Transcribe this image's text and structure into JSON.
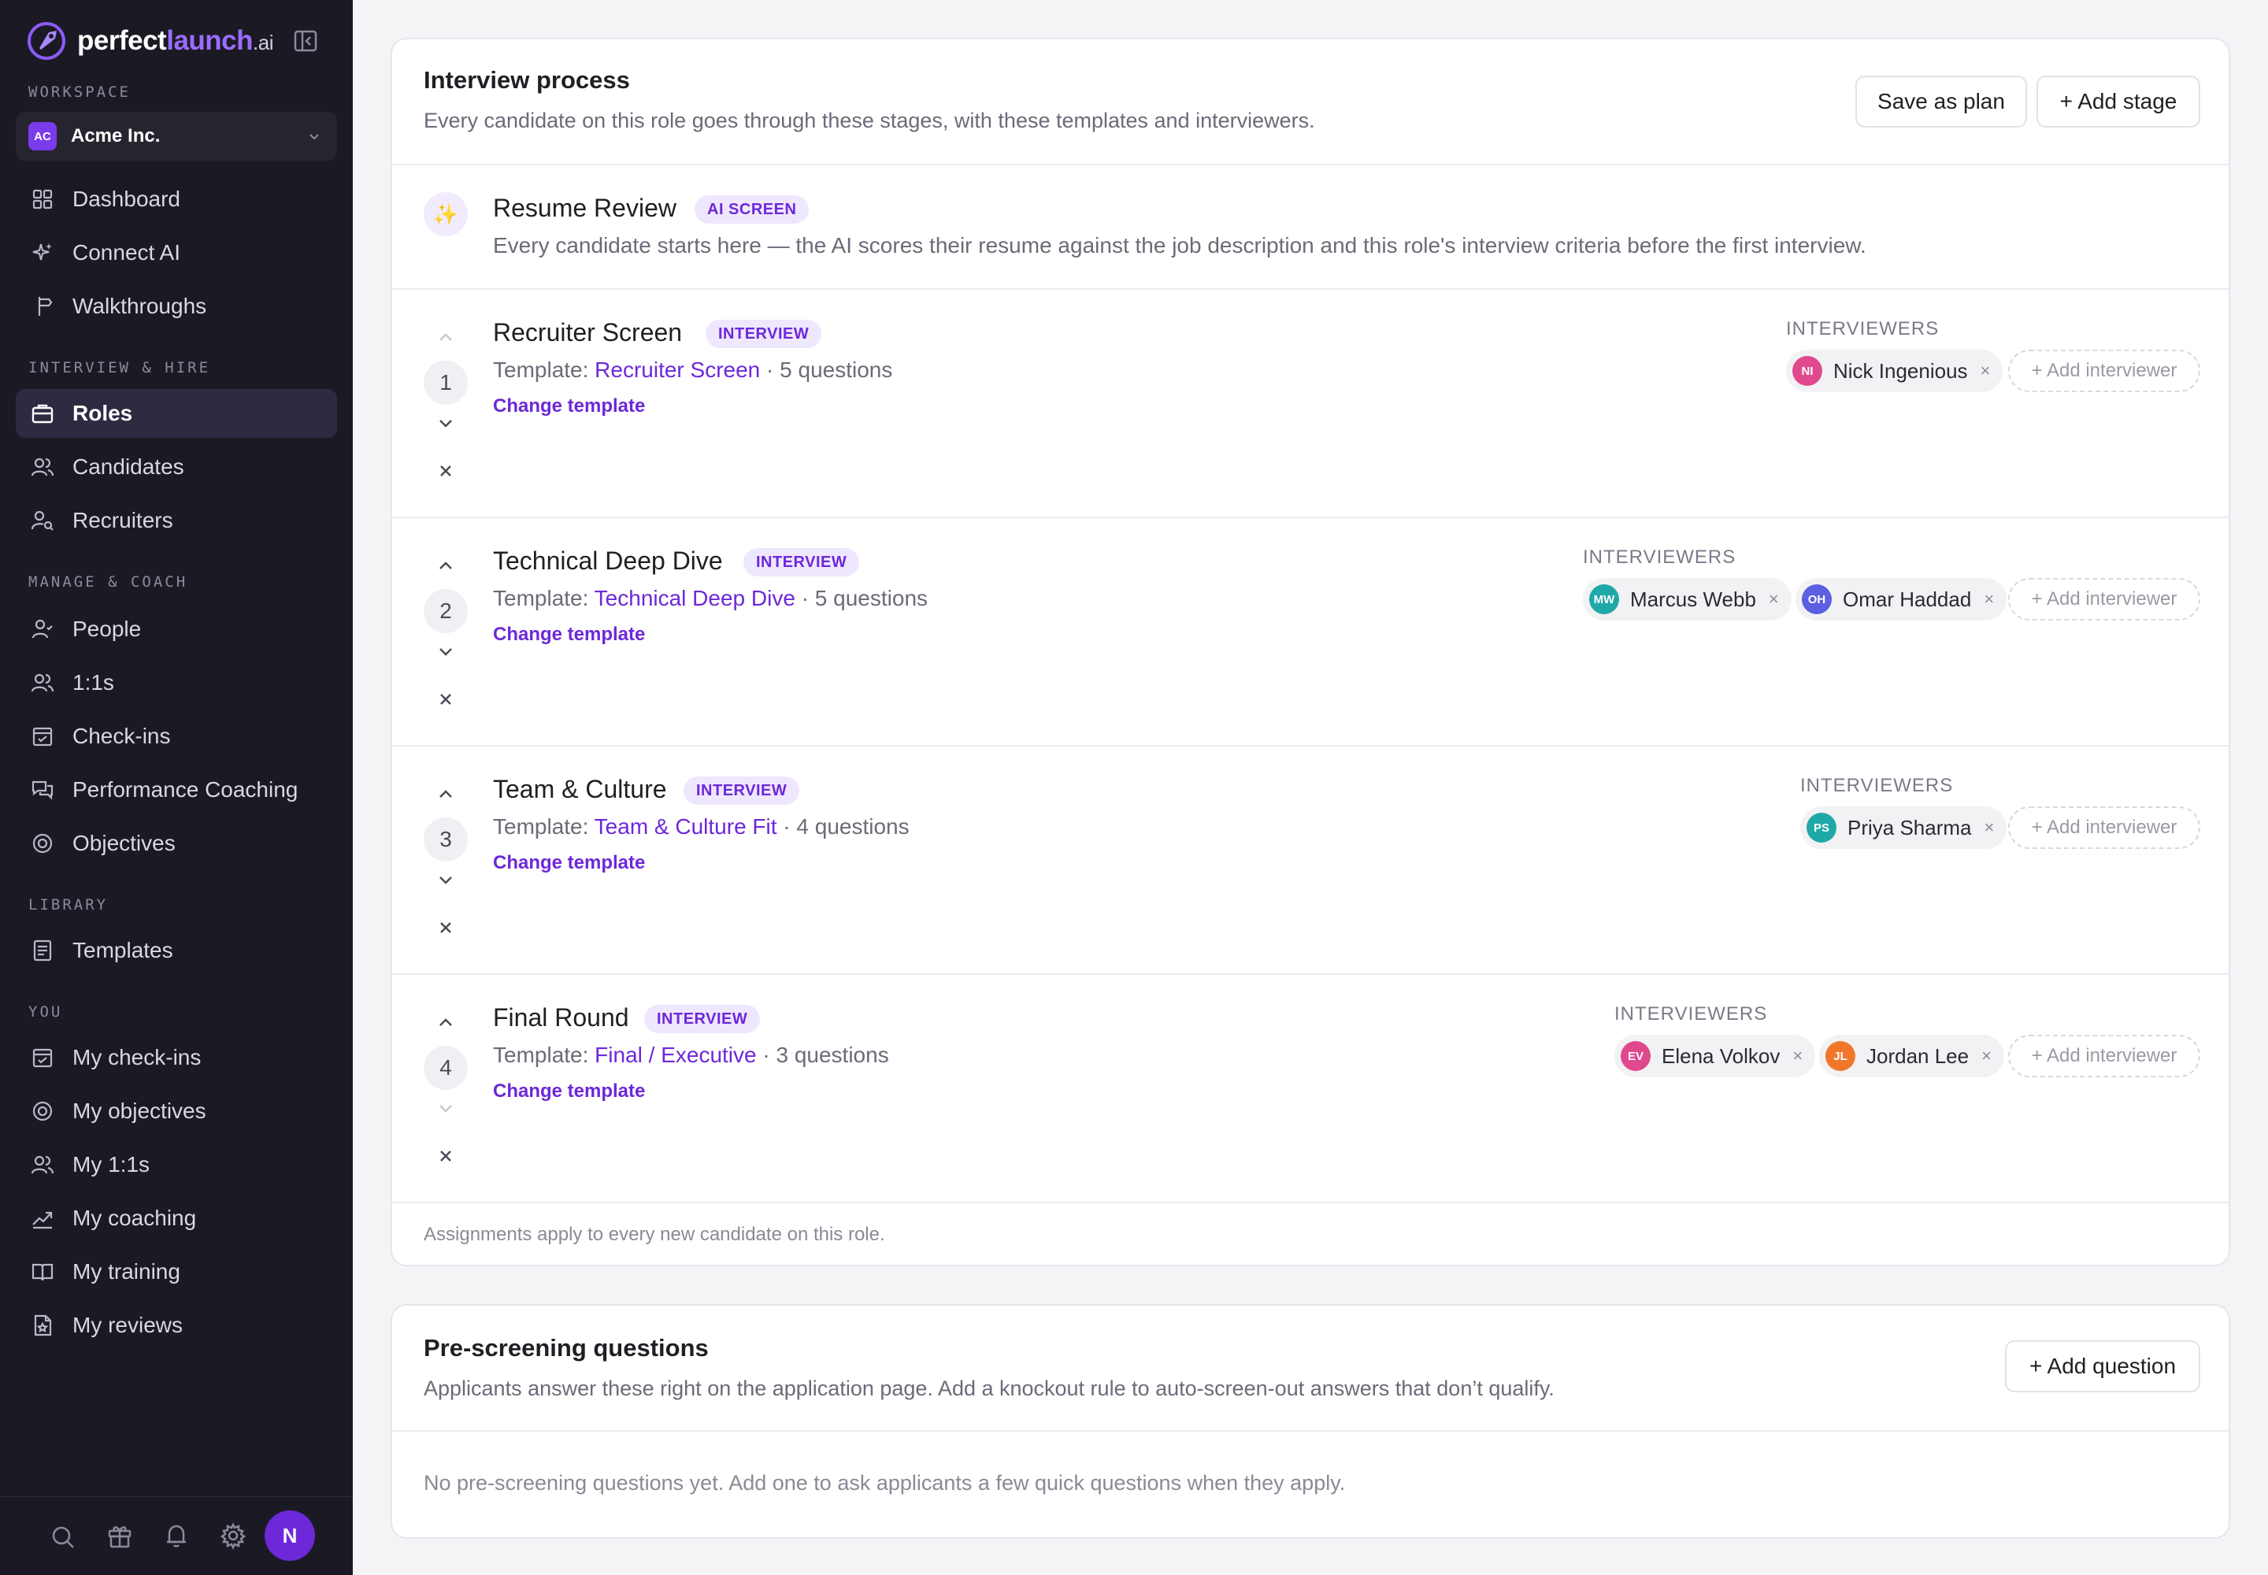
{
  "brand": {
    "name_main": "perfect",
    "name_accent": "launch",
    "name_suffix": ".ai"
  },
  "sidebar": {
    "workspace_label": "WORKSPACE",
    "workspace": {
      "badge": "AC",
      "name": "Acme Inc."
    },
    "sections": {
      "interview_hire": "INTERVIEW & HIRE",
      "manage_coach": "MANAGE & COACH",
      "library": "LIBRARY",
      "you": "YOU"
    },
    "items": [
      {
        "label": "Dashboard",
        "icon": "dashboard-icon"
      },
      {
        "label": "Connect AI",
        "icon": "sparkle-icon"
      },
      {
        "label": "Walkthroughs",
        "icon": "signpost-icon"
      },
      {
        "label": "Roles",
        "icon": "briefcase-icon",
        "active": true
      },
      {
        "label": "Candidates",
        "icon": "users-icon"
      },
      {
        "label": "Recruiters",
        "icon": "user-search-icon"
      },
      {
        "label": "People",
        "icon": "user-icon"
      },
      {
        "label": "1:1s",
        "icon": "users-icon"
      },
      {
        "label": "Check-ins",
        "icon": "calendar-check-icon"
      },
      {
        "label": "Performance Coaching",
        "icon": "chat-icon"
      },
      {
        "label": "Objectives",
        "icon": "target-icon"
      },
      {
        "label": "Templates",
        "icon": "document-icon"
      },
      {
        "label": "My check-ins",
        "icon": "calendar-check-icon"
      },
      {
        "label": "My objectives",
        "icon": "target-icon"
      },
      {
        "label": "My 1:1s",
        "icon": "users-icon"
      },
      {
        "label": "My coaching",
        "icon": "trend-icon"
      },
      {
        "label": "My training",
        "icon": "book-icon"
      },
      {
        "label": "My reviews",
        "icon": "review-icon"
      }
    ],
    "user_initial": "N"
  },
  "interview": {
    "title": "Interview process",
    "subtitle": "Every candidate on this role goes through these stages, with these templates and interviewers.",
    "save_plan": "Save as plan",
    "add_stage": "+ Add stage",
    "resume": {
      "title": "Resume Review",
      "tag": "AI SCREEN",
      "desc": "Every candidate starts here — the AI scores their resume against the job description and this role's interview criteria before the first interview."
    },
    "template_prefix": "Template: ",
    "change_template": "Change template",
    "interviewers_label": "INTERVIEWERS",
    "add_interviewer": "+ Add interviewer",
    "stages": [
      {
        "num": "1",
        "title": "Recruiter Screen",
        "tag": "INTERVIEW",
        "template": "Recruiter Screen",
        "questions": " · 5 questions",
        "interviewers": [
          {
            "initials": "NI",
            "name": "Nick Ingenious",
            "color": "#e0498e"
          }
        ]
      },
      {
        "num": "2",
        "title": "Technical Deep Dive",
        "tag": "INTERVIEW",
        "template": "Technical Deep Dive",
        "questions": " · 5 questions",
        "interviewers": [
          {
            "initials": "MW",
            "name": "Marcus Webb",
            "color": "#1fa8a8"
          },
          {
            "initials": "OH",
            "name": "Omar Haddad",
            "color": "#5b5fe0"
          }
        ]
      },
      {
        "num": "3",
        "title": "Team & Culture",
        "tag": "INTERVIEW",
        "template": "Team & Culture Fit",
        "questions": " · 4 questions",
        "interviewers": [
          {
            "initials": "PS",
            "name": "Priya Sharma",
            "color": "#1fa8a8"
          }
        ]
      },
      {
        "num": "4",
        "title": "Final Round",
        "tag": "INTERVIEW",
        "template": "Final / Executive",
        "questions": " · 3 questions",
        "interviewers": [
          {
            "initials": "EV",
            "name": "Elena Volkov",
            "color": "#e0498e"
          },
          {
            "initials": "JL",
            "name": "Jordan Lee",
            "color": "#f0772a"
          }
        ]
      }
    ],
    "footnote": "Assignments apply to every new candidate on this role."
  },
  "prescreen": {
    "title": "Pre-screening questions",
    "subtitle": "Applicants answer these right on the application page. Add a knockout rule to auto-screen-out answers that don’t qualify.",
    "add_question": "+ Add question",
    "empty": "No pre-screening questions yet. Add one to ask applicants a few quick questions when they apply."
  }
}
